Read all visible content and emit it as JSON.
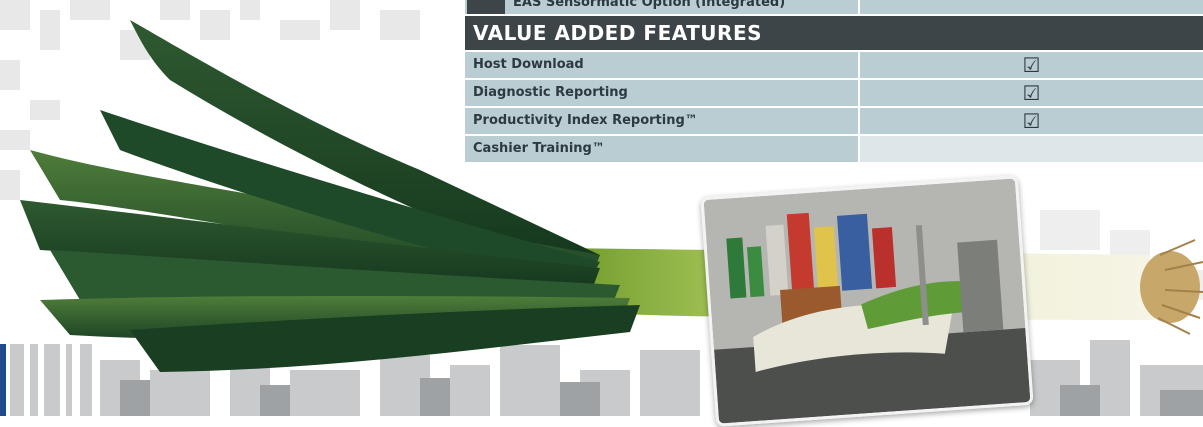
{
  "top_row": {
    "label": "EAS Sensormatic Option (Integrated)"
  },
  "section": {
    "title": "VALUE ADDED FEATURES"
  },
  "features": [
    {
      "label": "Host Download",
      "check": "☑"
    },
    {
      "label": "Diagnostic Reporting",
      "check": "☑"
    },
    {
      "label": "Productivity Index Reporting™",
      "check": "☑"
    },
    {
      "label": "Cashier Training™",
      "check": ""
    }
  ],
  "colors": {
    "header_bg": "#3e4548",
    "row_bg": "#b9cdd3",
    "accent_blue": "#1f4a8c"
  }
}
